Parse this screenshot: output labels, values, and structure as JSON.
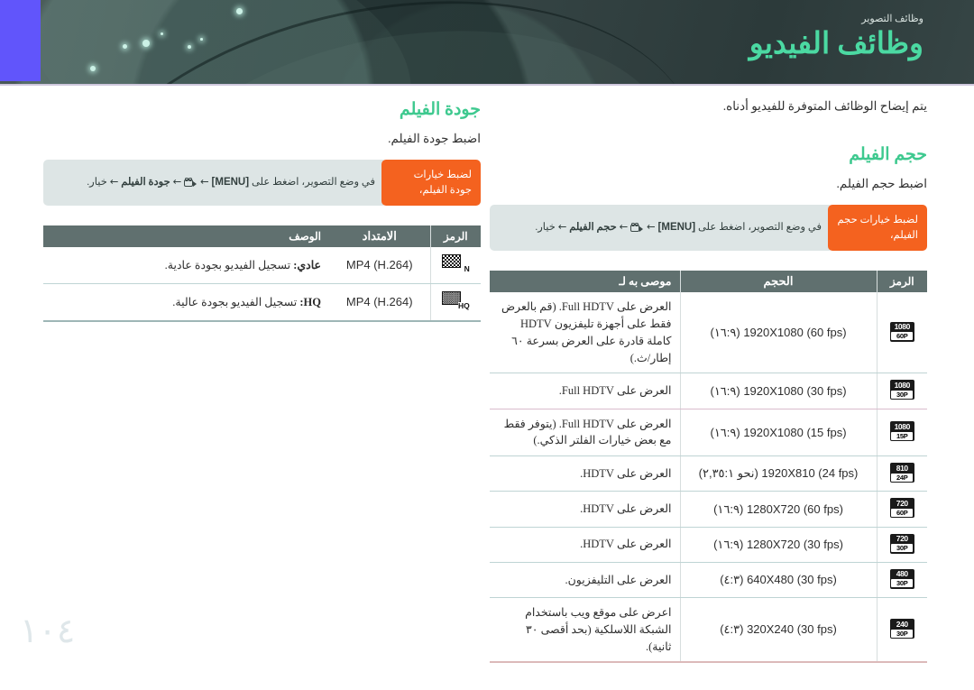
{
  "banner": {
    "eyebrow": "وظائف التصوير",
    "title": "وظائف الفيديو",
    "accent_color": "#4bd9a2",
    "background_color": "#39494a",
    "tab_color": "#6155fb"
  },
  "page_number": "١٠٤",
  "right_column": {
    "intro": "يتم إيضاح الوظائف المتوفرة للفيديو أدناه.",
    "section_title": "حجم الفيلم",
    "section_sub": "اضبط حجم الفيلم.",
    "callout": {
      "tab_label": "لضبط خيارات حجم الفيلم،",
      "body_prefix": "في وضع التصوير، اضغط على",
      "menu_key": "[MENU]",
      "arrow": "←",
      "icon_name": "record-camera-icon",
      "step_bold": "حجم الفيلم",
      "body_suffix": "خيار."
    },
    "table": {
      "headers": [
        "الرمز",
        "الحجم",
        "موصى به لـ"
      ],
      "rows": [
        {
          "icon_top": "1080",
          "icon_bot": "60P",
          "size": "1920X1080 (60 fps) (١٦:٩)",
          "rec": "العرض على Full HDTV. (قم بالعرض فقط على أجهزة تليفزيون HDTV كاملة قادرة على العرض بسرعة ٦٠ إطار/ث.)"
        },
        {
          "icon_top": "1080",
          "icon_bot": "30P",
          "size": "1920X1080 (30 fps) (١٦:٩)",
          "rec": "العرض على Full HDTV."
        },
        {
          "icon_top": "1080",
          "icon_bot": "15P",
          "size": "1920X1080 (15 fps) (١٦:٩)",
          "rec": "العرض على Full HDTV. (يتوفر فقط مع بعض خيارات الفلتر الذكي.)"
        },
        {
          "icon_top": "810",
          "icon_bot": "24P",
          "size": "1920X810 (24 fps) (نحو ٢,٣٥:١)",
          "rec": "العرض على HDTV."
        },
        {
          "icon_top": "720",
          "icon_bot": "60P",
          "size": "1280X720 (60 fps) (١٦:٩)",
          "rec": "العرض على HDTV."
        },
        {
          "icon_top": "720",
          "icon_bot": "30P",
          "size": "1280X720 (30 fps) (١٦:٩)",
          "rec": "العرض على HDTV."
        },
        {
          "icon_top": "480",
          "icon_bot": "30P",
          "size": "640X480 (30 fps) (٤:٣)",
          "rec": "العرض على التليفزيون."
        },
        {
          "icon_top": "240",
          "icon_bot": "30P",
          "size": "320X240 (30 fps) (٤:٣)",
          "rec": "اعرض على موقع ويب باستخدام الشبكة اللاسلكية (بحد أقصى ٣٠ ثانية)."
        }
      ]
    }
  },
  "left_column": {
    "section_title": "جودة الفيلم",
    "section_sub": "اضبط جودة الفيلم.",
    "callout": {
      "tab_label": "لضبط خيارات جودة الفيلم،",
      "body_prefix": "في وضع التصوير، اضغط على",
      "menu_key": "[MENU]",
      "arrow": "←",
      "icon_name": "record-camera-icon",
      "step_bold": "جودة الفيلم",
      "body_suffix": "خيار."
    },
    "table": {
      "headers": [
        "الرمز",
        "الامتداد",
        "الوصف"
      ],
      "rows": [
        {
          "icon_tag": "N",
          "icon_style": "normal",
          "ext": "MP4 (H.264)",
          "desc_bold": "عادي:",
          "desc": "تسجيل الفيديو بجودة عادية."
        },
        {
          "icon_tag": "HQ",
          "icon_style": "hq",
          "ext": "MP4 (H.264)",
          "desc_bold": "HQ:",
          "desc": "تسجيل الفيديو بجودة عالية."
        }
      ]
    }
  },
  "colors": {
    "accent_green": "#3ec98f",
    "callout_orange": "#f4621f",
    "callout_gray": "#dde5e5",
    "table_header": "#60706f"
  }
}
